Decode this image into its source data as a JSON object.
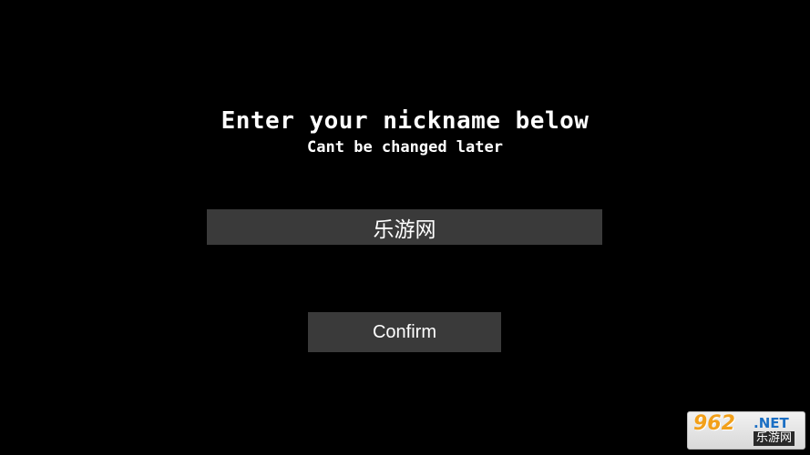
{
  "prompt": {
    "title": "Enter your nickname below",
    "subtitle": "Cant be changed later"
  },
  "nickname_input": {
    "value": "乐游网"
  },
  "confirm_button": {
    "label": "Confirm"
  },
  "watermark": {
    "number": "962",
    "domain": ".NET",
    "site_name": "乐游网"
  },
  "colors": {
    "background": "#000000",
    "panel": "#3a3a3a",
    "text": "#ffffff"
  }
}
